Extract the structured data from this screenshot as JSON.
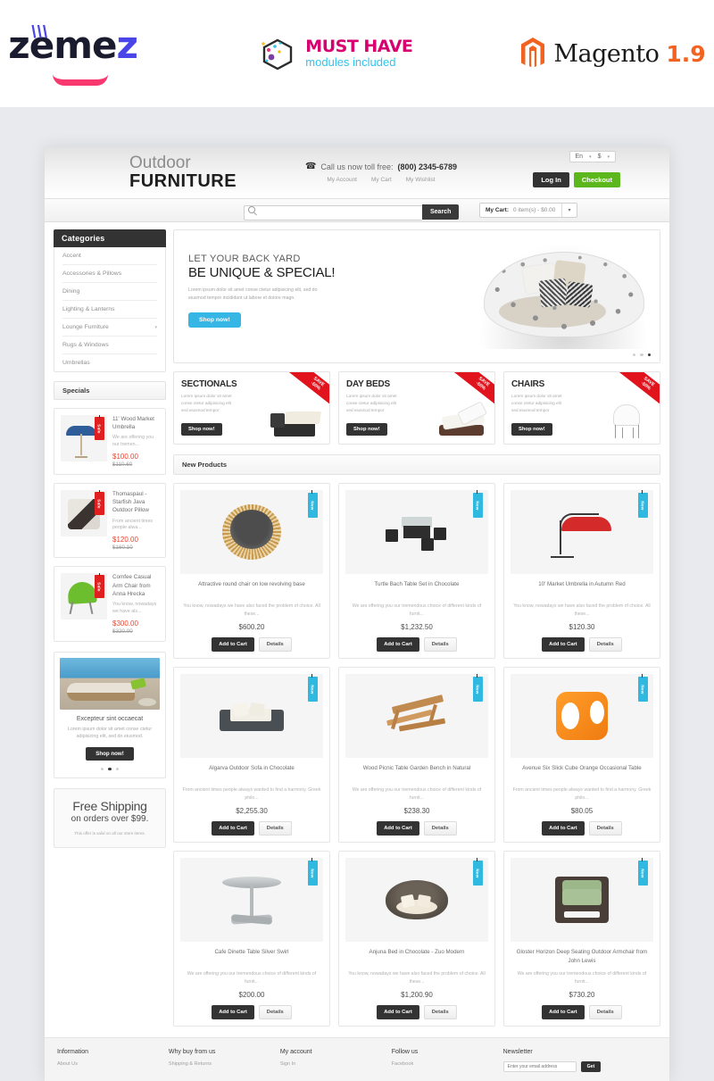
{
  "promo_strip": {
    "zemez": {
      "text_part1": "z",
      "text_em": "em",
      "text_part2": "e",
      "text_z2": "z"
    },
    "musthave": {
      "title": "MUST HAVE",
      "subtitle": "modules included"
    },
    "magento": {
      "name": "Magento",
      "version": "1.9"
    }
  },
  "header": {
    "brand_top": "Outdoor",
    "brand_bottom": "FURNITURE",
    "phone_label": "Call us now toll free:",
    "phone_number": "(800) 2345-6789",
    "links": [
      "My Account",
      "My Cart",
      "My Wishlist"
    ],
    "language": "En",
    "currency": "$",
    "login_label": "Log In",
    "checkout_label": "Checkout"
  },
  "navbar": {
    "search_placeholder": "",
    "search_value": "",
    "search_button": "Search",
    "cart_label": "My Cart:",
    "cart_value": "0 item(s) - $0.00"
  },
  "sidebar": {
    "categories_title": "Categories",
    "categories": [
      {
        "label": "Accent",
        "has_children": false
      },
      {
        "label": "Accessories & Pillows",
        "has_children": false
      },
      {
        "label": "Dining",
        "has_children": false
      },
      {
        "label": "Lighting & Lanterns",
        "has_children": false
      },
      {
        "label": "Lounge Furniture",
        "has_children": true
      },
      {
        "label": "Rugs & Windows",
        "has_children": false
      },
      {
        "label": "Umbrellas",
        "has_children": false
      }
    ],
    "specials_title": "Specials",
    "specials": [
      {
        "name": "11' Wood Market Umbrella",
        "desc": "We are offering you our tremen...",
        "price": "$100.00",
        "old_price": "$110.60",
        "badge": "Sale"
      },
      {
        "name": "Thomaspaul - Starfish Java Outdoor Pillow",
        "desc": "From ancient times people alwa...",
        "price": "$120.00",
        "old_price": "$160.10",
        "badge": "Sale"
      },
      {
        "name": "Comfee Casual Arm Chair from Anna Hrecka",
        "desc": "You know, nowadays we have als...",
        "price": "$300.00",
        "old_price": "$320.00",
        "badge": "Sale"
      }
    ],
    "side_banner": {
      "title": "Excepteur sint occaecat",
      "desc": "Lorem ipsum dolor sit amet conse ctetur adipisicing elit, sed do eiusmod.",
      "button": "Shop now!",
      "dots_count": 3,
      "active_dot": 1
    },
    "free_shipping": {
      "line1": "Free Shipping",
      "line2": "on orders over $99.",
      "line3": "This offer is valid on all our store items."
    }
  },
  "hero": {
    "line1": "LET YOUR BACK YARD",
    "line2": "BE UNIQUE & SPECIAL!",
    "desc": "Lorem ipsum dolor sit amet conse ctetur adipisicing elit, sed do eiusmod tempor incididunt ut labore et dolore magn.",
    "button": "Shop now!",
    "dots_count": 3,
    "active_dot": 2
  },
  "promos": [
    {
      "title": "SECTIONALS",
      "desc": "Lorem ipsum dolor sit amet conse ctetur adipisicing elit sed eiusmod tempor",
      "button": "Shop now!",
      "save_line1": "SAVE",
      "save_line2": "-50%"
    },
    {
      "title": "DAY BEDS",
      "desc": "Lorem ipsum dolor sit amet conse ctetur adipisicing elit sed eiusmod tempor",
      "button": "Shop now!",
      "save_line1": "SAVE",
      "save_line2": "-50%"
    },
    {
      "title": "CHAIRS",
      "desc": "Lorem ipsum dolor sit amet conse ctetur adipisicing elit sed eiusmod tempor",
      "button": "Shop now!",
      "save_line1": "SAVE",
      "save_line2": "-50%"
    }
  ],
  "new_products": {
    "title": "New Products",
    "badge": "New",
    "add_to_cart": "Add to Cart",
    "details": "Details",
    "items": [
      {
        "name": "Attractive round chair on low revolving base",
        "desc": "You know, nowadays we have also faced the problem of choice. All these...",
        "price": "$600.20"
      },
      {
        "name": "Turtle Bach Table Set in Chocolate",
        "desc": "We are offering you our tremendous choice of different kinds of furnit...",
        "price": "$1,232.50"
      },
      {
        "name": "10' Market Umbrella in Autumn Red",
        "desc": "You know, nowadays we have also faced the problem of choice. All these...",
        "price": "$120.30"
      },
      {
        "name": "Algarva Outdoor Sofa in Chocolate",
        "desc": "From ancient times people always wanted to find a harmony. Greek philo...",
        "price": "$2,255.30"
      },
      {
        "name": "Wood Picnic Table Garden Bench in Natural",
        "desc": "We are offering you our tremendous choice of different kinds of furnit...",
        "price": "$238.30"
      },
      {
        "name": "Avenue Six Slick Cube Orange Occasional Table",
        "desc": "From ancient times people always wanted to find a harmony. Greek philo...",
        "price": "$80.05"
      },
      {
        "name": "Cafe Dinette Table Silver Swirl",
        "desc": "We are offering you our tremendous choice of different kinds of furnit...",
        "price": "$200.00"
      },
      {
        "name": "Anjuna Bed in Chocolate - Zuo Modern",
        "desc": "You know, nowadays we have also faced the problem of choice. All these...",
        "price": "$1,200.90"
      },
      {
        "name": "Gloster Horizon Deep Seating Outdoor Armchair from John Lewis",
        "desc": "We are offering you our tremendous choice of different kinds of furnit...",
        "price": "$730.20"
      }
    ]
  },
  "footer": {
    "columns": [
      {
        "title": "Information",
        "links": [
          "About Us"
        ]
      },
      {
        "title": "Why buy from us",
        "links": [
          "Shipping & Returns"
        ]
      },
      {
        "title": "My account",
        "links": [
          "Sign In"
        ]
      },
      {
        "title": "Follow us",
        "links": [
          "Facebook"
        ]
      }
    ],
    "newsletter": {
      "title": "Newsletter",
      "placeholder": "Enter your email address",
      "button": "Get"
    }
  },
  "colors": {
    "accent_blue": "#35b6e5",
    "checkout_green": "#5bb71b",
    "sale_red": "#e1131d",
    "price_red": "#e8462f",
    "dark": "#333333"
  }
}
